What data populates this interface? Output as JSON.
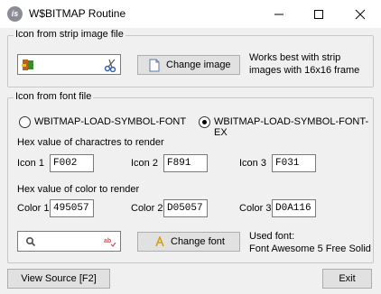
{
  "window": {
    "title": "W$BITMAP Routine",
    "app_icon_text": "is"
  },
  "strip_group": {
    "legend": "Icon from strip image file",
    "change_image_label": "Change image",
    "hint_line1": "Works best with strip",
    "hint_line2": "images with 16x16 frame"
  },
  "font_group": {
    "legend": "Icon from font file",
    "radio1_label": "WBITMAP-LOAD-SYMBOL-FONT",
    "radio2_label": "WBITMAP-LOAD-SYMBOL-FONT-EX",
    "selected_radio": 2,
    "hex_icons_heading": "Hex value of charactres to render",
    "icon1_label": "Icon 1",
    "icon1_value": "F002",
    "icon2_label": "Icon 2",
    "icon2_value": "F891",
    "icon3_label": "Icon 3",
    "icon3_value": "F031",
    "hex_colors_heading": "Hex value of color to render",
    "color1_label": "Color 1",
    "color1_value": "495057",
    "color2_label": "Color 2",
    "color2_value": "D05057",
    "color3_label": "Color 3",
    "color3_value": "D0A116",
    "change_font_label": "Change font",
    "used_font_label": "Used font:",
    "used_font_value": "Font Awesome 5 Free Solid"
  },
  "footer": {
    "view_source_label": "View Source [F2]",
    "exit_label": "Exit"
  },
  "colors": {
    "preview_search_icon": "#495057",
    "preview_spell_icon": "#D05057",
    "font_glyph": "#D0A116"
  }
}
